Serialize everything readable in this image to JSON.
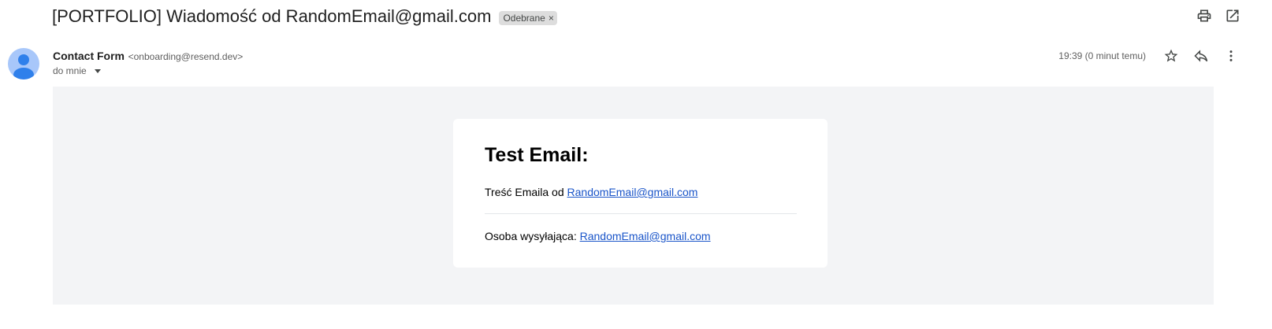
{
  "header": {
    "subject": "[PORTFOLIO] Wiadomość od RandomEmail@gmail.com",
    "label": "Odebrane",
    "label_close": "×",
    "actions": [
      "print-icon",
      "open-in-new-window-icon"
    ]
  },
  "message": {
    "sender_name": "Contact Form",
    "sender_email": "<onboarding@resend.dev>",
    "to_line": "do mnie",
    "time": "19:39 (0 minut temu)",
    "actions": [
      "star-icon",
      "reply-icon",
      "more-vert-icon"
    ]
  },
  "body": {
    "title": "Test Email:",
    "content_prefix": "Treść Emaila od",
    "content_link": "RandomEmail@gmail.com",
    "sender_prefix": "Osoba wysyłająca:",
    "sender_link": "RandomEmail@gmail.com",
    "background_color": "#f3f4f6",
    "link_color": "#1a55c9"
  }
}
